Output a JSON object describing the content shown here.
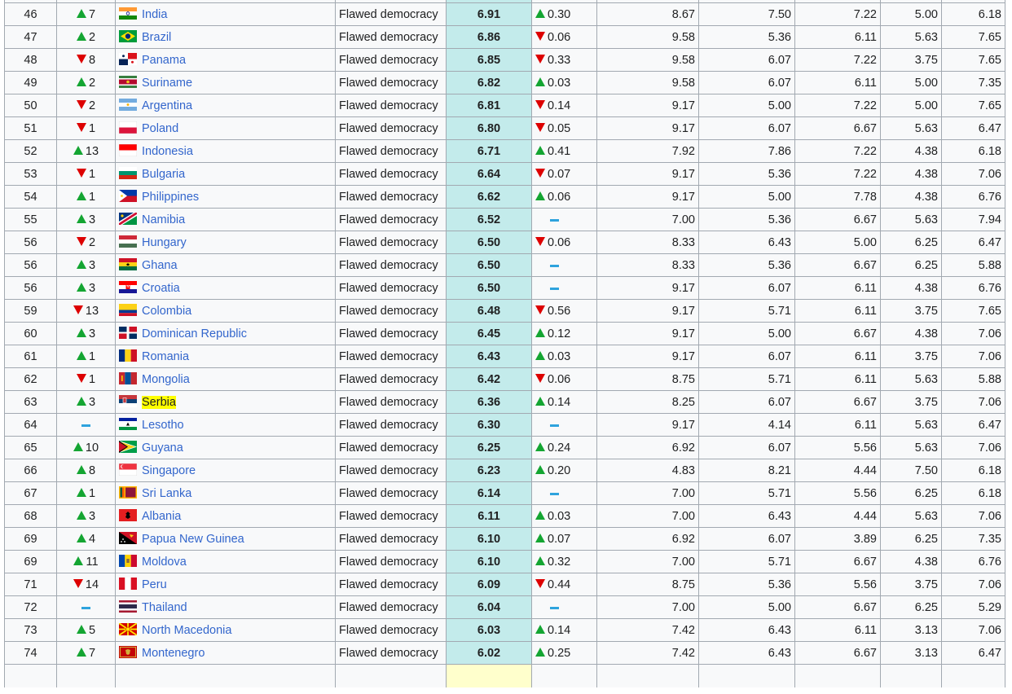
{
  "rows": [
    {
      "rank": "",
      "change_dir": "",
      "change": "",
      "country": "",
      "flag": "",
      "regime": "",
      "score": "",
      "delta_dir": "",
      "delta": "",
      "e1": "",
      "e2": "",
      "e3": "",
      "e4": "",
      "e5": "",
      "filler": true
    },
    {
      "rank": "46",
      "change_dir": "up",
      "change": "7",
      "country": "India",
      "flag": "india",
      "regime": "Flawed democracy",
      "score": "6.91",
      "delta_dir": "up",
      "delta": "0.30",
      "e1": "8.67",
      "e2": "7.50",
      "e3": "7.22",
      "e4": "5.00",
      "e5": "6.18"
    },
    {
      "rank": "47",
      "change_dir": "up",
      "change": "2",
      "country": "Brazil",
      "flag": "brazil",
      "regime": "Flawed democracy",
      "score": "6.86",
      "delta_dir": "down",
      "delta": "0.06",
      "e1": "9.58",
      "e2": "5.36",
      "e3": "6.11",
      "e4": "5.63",
      "e5": "7.65"
    },
    {
      "rank": "48",
      "change_dir": "down",
      "change": "8",
      "country": "Panama",
      "flag": "panama",
      "regime": "Flawed democracy",
      "score": "6.85",
      "delta_dir": "down",
      "delta": "0.33",
      "e1": "9.58",
      "e2": "6.07",
      "e3": "7.22",
      "e4": "3.75",
      "e5": "7.65"
    },
    {
      "rank": "49",
      "change_dir": "up",
      "change": "2",
      "country": "Suriname",
      "flag": "suriname",
      "regime": "Flawed democracy",
      "score": "6.82",
      "delta_dir": "up",
      "delta": "0.03",
      "e1": "9.58",
      "e2": "6.07",
      "e3": "6.11",
      "e4": "5.00",
      "e5": "7.35"
    },
    {
      "rank": "50",
      "change_dir": "down",
      "change": "2",
      "country": "Argentina",
      "flag": "argentina",
      "regime": "Flawed democracy",
      "score": "6.81",
      "delta_dir": "down",
      "delta": "0.14",
      "e1": "9.17",
      "e2": "5.00",
      "e3": "7.22",
      "e4": "5.00",
      "e5": "7.65"
    },
    {
      "rank": "51",
      "change_dir": "down",
      "change": "1",
      "country": "Poland",
      "flag": "poland",
      "regime": "Flawed democracy",
      "score": "6.80",
      "delta_dir": "down",
      "delta": "0.05",
      "e1": "9.17",
      "e2": "6.07",
      "e3": "6.67",
      "e4": "5.63",
      "e5": "6.47"
    },
    {
      "rank": "52",
      "change_dir": "up",
      "change": "13",
      "country": "Indonesia",
      "flag": "indonesia",
      "regime": "Flawed democracy",
      "score": "6.71",
      "delta_dir": "up",
      "delta": "0.41",
      "e1": "7.92",
      "e2": "7.86",
      "e3": "7.22",
      "e4": "4.38",
      "e5": "6.18"
    },
    {
      "rank": "53",
      "change_dir": "down",
      "change": "1",
      "country": "Bulgaria",
      "flag": "bulgaria",
      "regime": "Flawed democracy",
      "score": "6.64",
      "delta_dir": "down",
      "delta": "0.07",
      "e1": "9.17",
      "e2": "5.36",
      "e3": "7.22",
      "e4": "4.38",
      "e5": "7.06"
    },
    {
      "rank": "54",
      "change_dir": "up",
      "change": "1",
      "country": "Philippines",
      "flag": "philippines",
      "regime": "Flawed democracy",
      "score": "6.62",
      "delta_dir": "up",
      "delta": "0.06",
      "e1": "9.17",
      "e2": "5.00",
      "e3": "7.78",
      "e4": "4.38",
      "e5": "6.76"
    },
    {
      "rank": "55",
      "change_dir": "up",
      "change": "3",
      "country": "Namibia",
      "flag": "namibia",
      "regime": "Flawed democracy",
      "score": "6.52",
      "delta_dir": "none",
      "delta": "",
      "e1": "7.00",
      "e2": "5.36",
      "e3": "6.67",
      "e4": "5.63",
      "e5": "7.94"
    },
    {
      "rank": "56",
      "change_dir": "down",
      "change": "2",
      "country": "Hungary",
      "flag": "hungary",
      "regime": "Flawed democracy",
      "score": "6.50",
      "delta_dir": "down",
      "delta": "0.06",
      "e1": "8.33",
      "e2": "6.43",
      "e3": "5.00",
      "e4": "6.25",
      "e5": "6.47"
    },
    {
      "rank": "56",
      "change_dir": "up",
      "change": "3",
      "country": "Ghana",
      "flag": "ghana",
      "regime": "Flawed democracy",
      "score": "6.50",
      "delta_dir": "none",
      "delta": "",
      "e1": "8.33",
      "e2": "5.36",
      "e3": "6.67",
      "e4": "6.25",
      "e5": "5.88"
    },
    {
      "rank": "56",
      "change_dir": "up",
      "change": "3",
      "country": "Croatia",
      "flag": "croatia",
      "regime": "Flawed democracy",
      "score": "6.50",
      "delta_dir": "none",
      "delta": "",
      "e1": "9.17",
      "e2": "6.07",
      "e3": "6.11",
      "e4": "4.38",
      "e5": "6.76"
    },
    {
      "rank": "59",
      "change_dir": "down",
      "change": "13",
      "country": "Colombia",
      "flag": "colombia",
      "regime": "Flawed democracy",
      "score": "6.48",
      "delta_dir": "down",
      "delta": "0.56",
      "e1": "9.17",
      "e2": "5.71",
      "e3": "6.11",
      "e4": "3.75",
      "e5": "7.65"
    },
    {
      "rank": "60",
      "change_dir": "up",
      "change": "3",
      "country": "Dominican Republic",
      "flag": "dominican",
      "regime": "Flawed democracy",
      "score": "6.45",
      "delta_dir": "up",
      "delta": "0.12",
      "e1": "9.17",
      "e2": "5.00",
      "e3": "6.67",
      "e4": "4.38",
      "e5": "7.06"
    },
    {
      "rank": "61",
      "change_dir": "up",
      "change": "1",
      "country": "Romania",
      "flag": "romania",
      "regime": "Flawed democracy",
      "score": "6.43",
      "delta_dir": "up",
      "delta": "0.03",
      "e1": "9.17",
      "e2": "6.07",
      "e3": "6.11",
      "e4": "3.75",
      "e5": "7.06"
    },
    {
      "rank": "62",
      "change_dir": "down",
      "change": "1",
      "country": "Mongolia",
      "flag": "mongolia",
      "regime": "Flawed democracy",
      "score": "6.42",
      "delta_dir": "down",
      "delta": "0.06",
      "e1": "8.75",
      "e2": "5.71",
      "e3": "6.11",
      "e4": "5.63",
      "e5": "5.88"
    },
    {
      "rank": "63",
      "change_dir": "up",
      "change": "3",
      "country": "Serbia",
      "flag": "serbia",
      "highlight": true,
      "regime": "Flawed democracy",
      "score": "6.36",
      "delta_dir": "up",
      "delta": "0.14",
      "e1": "8.25",
      "e2": "6.07",
      "e3": "6.67",
      "e4": "3.75",
      "e5": "7.06"
    },
    {
      "rank": "64",
      "change_dir": "none",
      "change": "",
      "country": "Lesotho",
      "flag": "lesotho",
      "regime": "Flawed democracy",
      "score": "6.30",
      "delta_dir": "none",
      "delta": "",
      "e1": "9.17",
      "e2": "4.14",
      "e3": "6.11",
      "e4": "5.63",
      "e5": "6.47"
    },
    {
      "rank": "65",
      "change_dir": "up",
      "change": "10",
      "country": "Guyana",
      "flag": "guyana",
      "regime": "Flawed democracy",
      "score": "6.25",
      "delta_dir": "up",
      "delta": "0.24",
      "e1": "6.92",
      "e2": "6.07",
      "e3": "5.56",
      "e4": "5.63",
      "e5": "7.06"
    },
    {
      "rank": "66",
      "change_dir": "up",
      "change": "8",
      "country": "Singapore",
      "flag": "singapore",
      "regime": "Flawed democracy",
      "score": "6.23",
      "delta_dir": "up",
      "delta": "0.20",
      "e1": "4.83",
      "e2": "8.21",
      "e3": "4.44",
      "e4": "7.50",
      "e5": "6.18"
    },
    {
      "rank": "67",
      "change_dir": "up",
      "change": "1",
      "country": "Sri Lanka",
      "flag": "srilanka",
      "regime": "Flawed democracy",
      "score": "6.14",
      "delta_dir": "none",
      "delta": "",
      "e1": "7.00",
      "e2": "5.71",
      "e3": "5.56",
      "e4": "6.25",
      "e5": "6.18"
    },
    {
      "rank": "68",
      "change_dir": "up",
      "change": "3",
      "country": "Albania",
      "flag": "albania",
      "regime": "Flawed democracy",
      "score": "6.11",
      "delta_dir": "up",
      "delta": "0.03",
      "e1": "7.00",
      "e2": "6.43",
      "e3": "4.44",
      "e4": "5.63",
      "e5": "7.06"
    },
    {
      "rank": "69",
      "change_dir": "up",
      "change": "4",
      "country": "Papua New Guinea",
      "flag": "png",
      "regime": "Flawed democracy",
      "score": "6.10",
      "delta_dir": "up",
      "delta": "0.07",
      "e1": "6.92",
      "e2": "6.07",
      "e3": "3.89",
      "e4": "6.25",
      "e5": "7.35"
    },
    {
      "rank": "69",
      "change_dir": "up",
      "change": "11",
      "country": "Moldova",
      "flag": "moldova",
      "regime": "Flawed democracy",
      "score": "6.10",
      "delta_dir": "up",
      "delta": "0.32",
      "e1": "7.00",
      "e2": "5.71",
      "e3": "6.67",
      "e4": "4.38",
      "e5": "6.76"
    },
    {
      "rank": "71",
      "change_dir": "down",
      "change": "14",
      "country": "Peru",
      "flag": "peru",
      "regime": "Flawed democracy",
      "score": "6.09",
      "delta_dir": "down",
      "delta": "0.44",
      "e1": "8.75",
      "e2": "5.36",
      "e3": "5.56",
      "e4": "3.75",
      "e5": "7.06"
    },
    {
      "rank": "72",
      "change_dir": "none",
      "change": "",
      "country": "Thailand",
      "flag": "thailand",
      "regime": "Flawed democracy",
      "score": "6.04",
      "delta_dir": "none",
      "delta": "",
      "e1": "7.00",
      "e2": "5.00",
      "e3": "6.67",
      "e4": "6.25",
      "e5": "5.29"
    },
    {
      "rank": "73",
      "change_dir": "up",
      "change": "5",
      "country": "North Macedonia",
      "flag": "macedonia",
      "regime": "Flawed democracy",
      "score": "6.03",
      "delta_dir": "up",
      "delta": "0.14",
      "e1": "7.42",
      "e2": "6.43",
      "e3": "6.11",
      "e4": "3.13",
      "e5": "7.06"
    },
    {
      "rank": "74",
      "change_dir": "up",
      "change": "7",
      "country": "Montenegro",
      "flag": "montenegro",
      "regime": "Flawed democracy",
      "score": "6.02",
      "delta_dir": "up",
      "delta": "0.25",
      "e1": "7.42",
      "e2": "6.43",
      "e3": "6.67",
      "e4": "3.13",
      "e5": "6.47"
    },
    {
      "rank": "",
      "change_dir": "",
      "change": "",
      "country": "",
      "flag": "",
      "regime": "",
      "score": "",
      "delta_dir": "",
      "delta": "",
      "e1": "",
      "e2": "",
      "e3": "",
      "e4": "",
      "e5": "",
      "partial": true
    }
  ]
}
